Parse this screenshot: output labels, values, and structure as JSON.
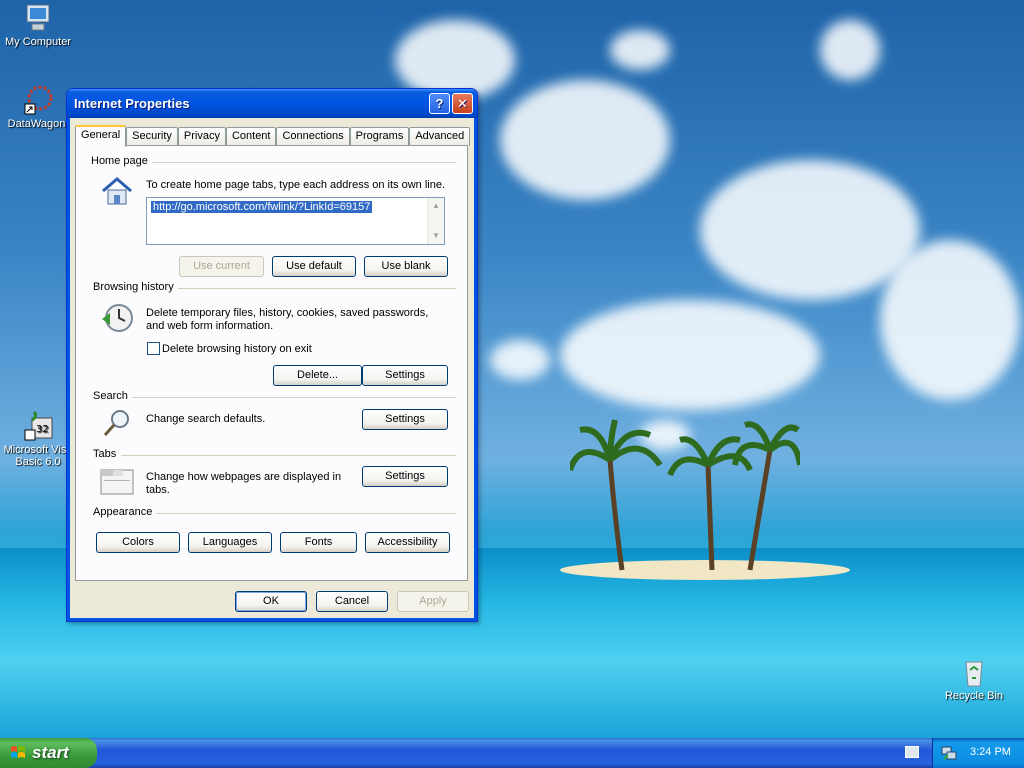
{
  "desktop": {
    "icons": [
      {
        "label": "My Computer"
      },
      {
        "label": "DataWagon."
      },
      {
        "label": "Microsoft Visu Basic 6.0"
      },
      {
        "label": "Recycle Bin"
      }
    ]
  },
  "dialog": {
    "title": "Internet Properties",
    "help_glyph": "?",
    "close_glyph": "✕",
    "tabs": [
      "General",
      "Security",
      "Privacy",
      "Content",
      "Connections",
      "Programs",
      "Advanced"
    ],
    "active_tab": "General",
    "home_page": {
      "group_label": "Home page",
      "instruction": "To create home page tabs, type each address on its own line.",
      "url": "http://go.microsoft.com/fwlink/?LinkId=69157",
      "use_current": "Use current",
      "use_default": "Use default",
      "use_blank": "Use blank"
    },
    "browsing_history": {
      "group_label": "Browsing history",
      "description": "Delete temporary files, history, cookies, saved passwords, and web form information.",
      "checkbox_label": "Delete browsing history on exit",
      "checkbox_checked": false,
      "delete_button": "Delete...",
      "settings_button": "Settings"
    },
    "search": {
      "group_label": "Search",
      "description": "Change search defaults.",
      "settings_button": "Settings"
    },
    "tabs_section": {
      "group_label": "Tabs",
      "description": "Change how webpages are displayed in tabs.",
      "settings_button": "Settings"
    },
    "appearance": {
      "group_label": "Appearance",
      "buttons": [
        "Colors",
        "Languages",
        "Fonts",
        "Accessibility"
      ]
    },
    "footer": {
      "ok": "OK",
      "cancel": "Cancel",
      "apply": "Apply"
    }
  },
  "taskbar": {
    "start_label": "start",
    "clock": "3:24 PM"
  },
  "colors": {
    "titlebar": "#0054e3",
    "selection": "#316ac5",
    "start_button": "#3c9a3c"
  }
}
